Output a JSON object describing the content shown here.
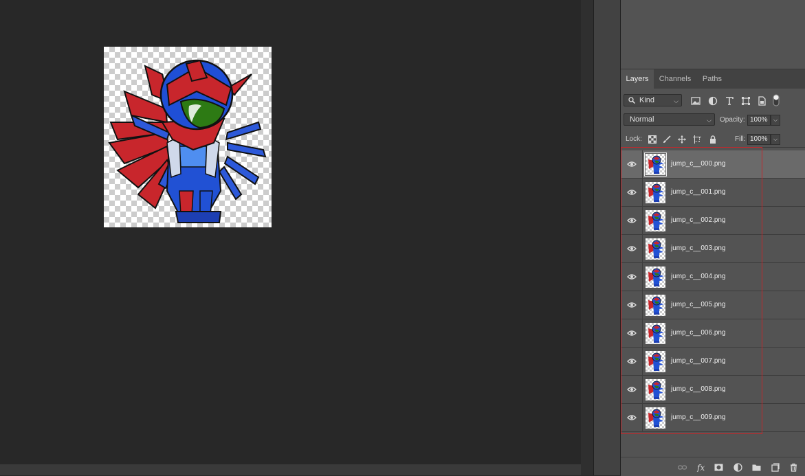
{
  "layers_panel": {
    "tabs": [
      {
        "label": "Layers",
        "active": true
      },
      {
        "label": "Channels",
        "active": false
      },
      {
        "label": "Paths",
        "active": false
      }
    ],
    "filter": {
      "kind_label": "Kind",
      "icons": [
        "image-filter-icon",
        "adjustment-filter-icon",
        "type-filter-icon",
        "shape-filter-icon",
        "smart-object-filter-icon",
        "filter-toggle-icon"
      ]
    },
    "blend_mode": "Normal",
    "opacity_label": "Opacity:",
    "opacity_value": "100%",
    "lock_label": "Lock:",
    "fill_label": "Fill:",
    "fill_value": "100%",
    "layers": [
      {
        "name": "jump_c__000.png",
        "visible": true,
        "selected": true
      },
      {
        "name": "jump_c__001.png",
        "visible": true,
        "selected": false
      },
      {
        "name": "jump_c__002.png",
        "visible": true,
        "selected": false
      },
      {
        "name": "jump_c__003.png",
        "visible": true,
        "selected": false
      },
      {
        "name": "jump_c__004.png",
        "visible": true,
        "selected": false
      },
      {
        "name": "jump_c__005.png",
        "visible": true,
        "selected": false
      },
      {
        "name": "jump_c__006.png",
        "visible": true,
        "selected": false
      },
      {
        "name": "jump_c__007.png",
        "visible": true,
        "selected": false
      },
      {
        "name": "jump_c__008.png",
        "visible": true,
        "selected": false
      },
      {
        "name": "jump_c__009.png",
        "visible": true,
        "selected": false
      }
    ],
    "bottom_icons": [
      "link-layers-icon",
      "fx-icon",
      "layer-mask-icon",
      "adjustment-layer-icon",
      "new-group-icon",
      "new-layer-icon",
      "delete-layer-icon"
    ]
  },
  "colors": {
    "canvas_bg": "#282828",
    "panel_bg": "#535353",
    "selected_row": "#6a6a6a",
    "highlight_box": "#c4272b",
    "character_blue": "#1f4fd6",
    "character_red": "#c8262c",
    "visor_green": "#2d7a14"
  }
}
